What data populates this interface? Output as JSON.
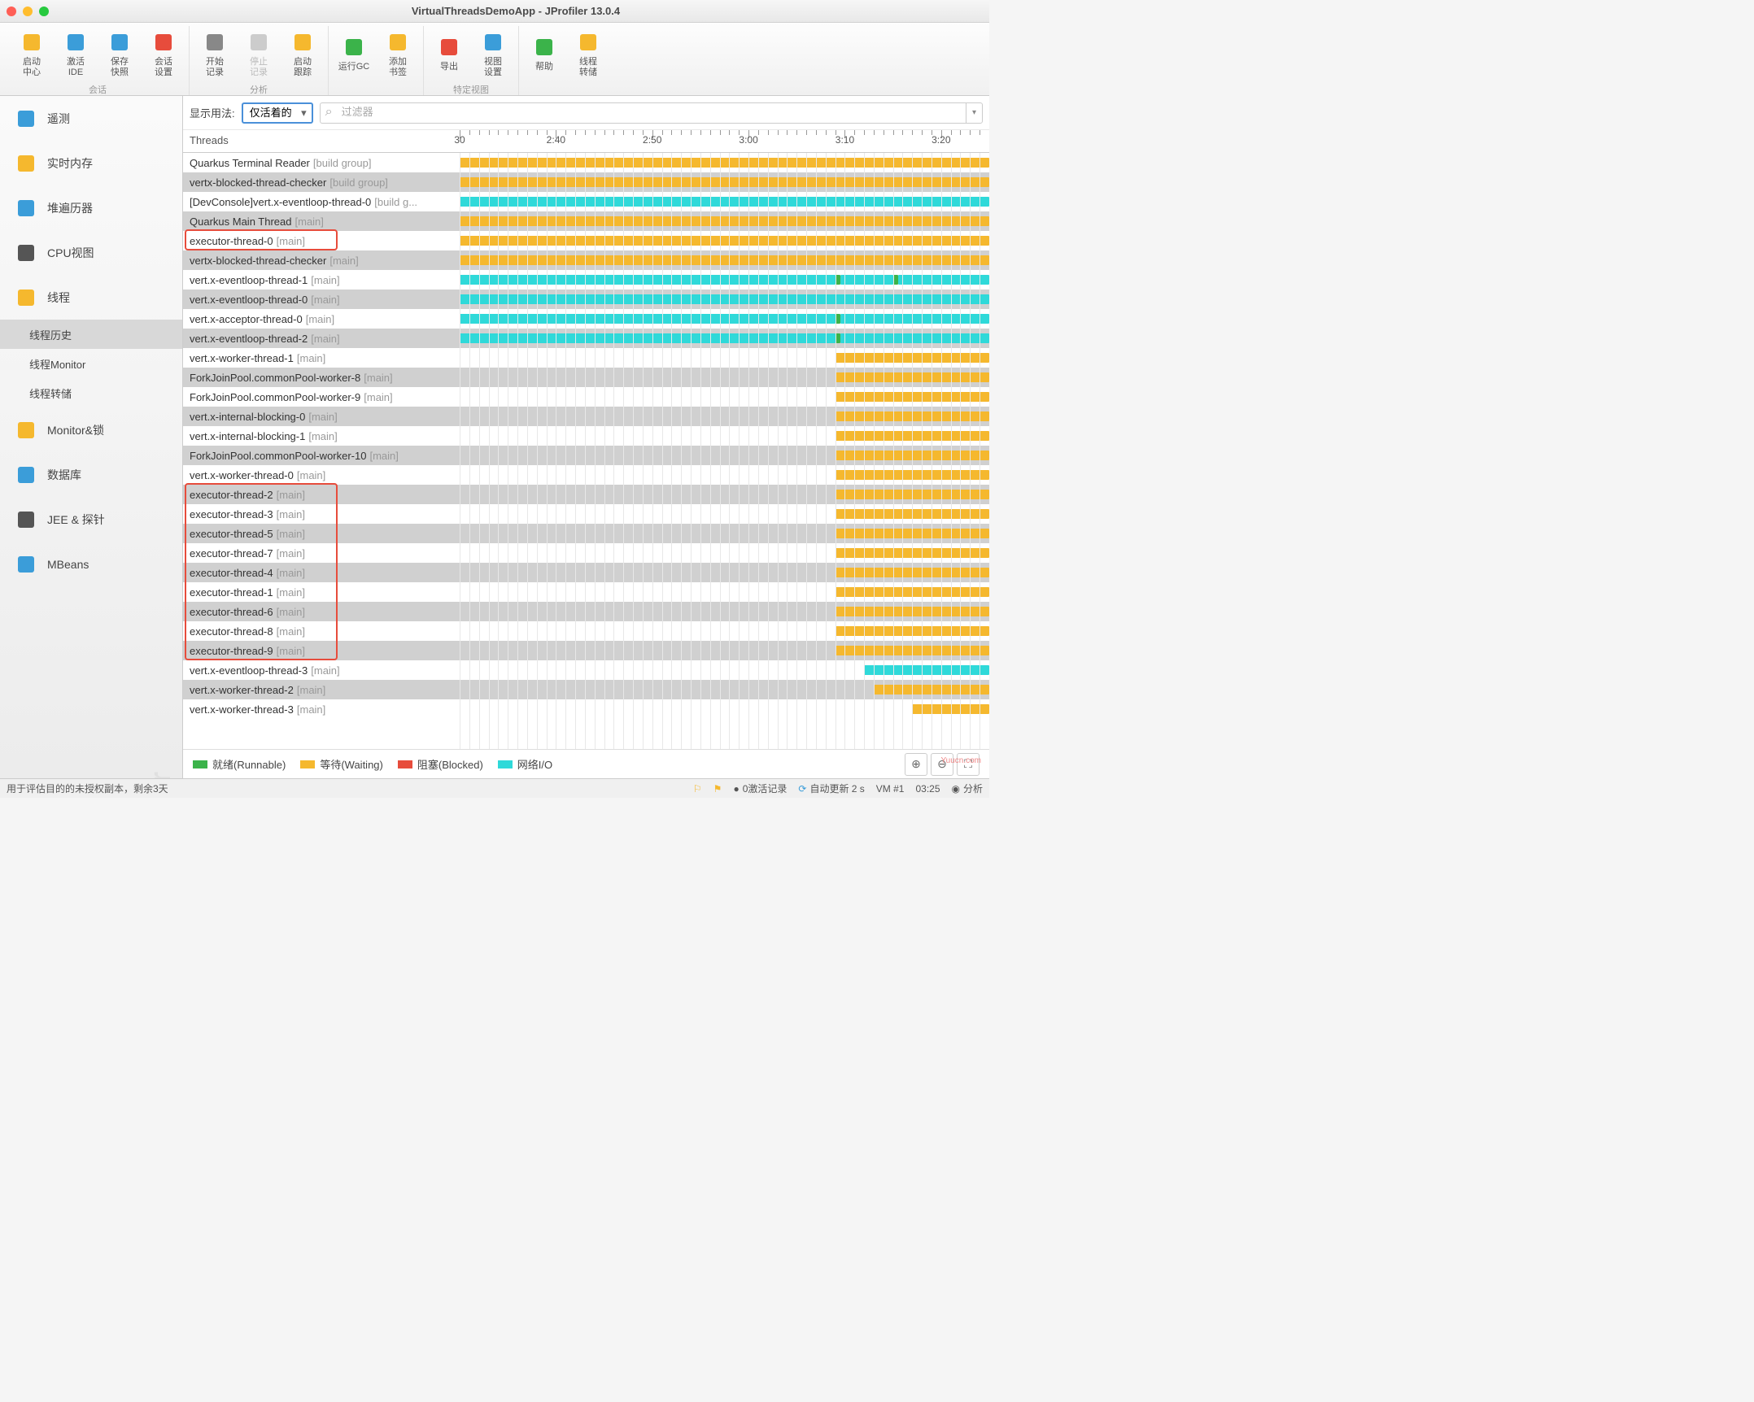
{
  "window_title": "VirtualThreadsDemoApp - JProfiler 13.0.4",
  "toolbar_groups": [
    {
      "label": "会话",
      "buttons": [
        {
          "name": "start-center",
          "label": "启动\n中心",
          "color": "#f5b82e"
        },
        {
          "name": "activate-ide",
          "label": "激活\nIDE",
          "color": "#3b9dd9"
        },
        {
          "name": "save-snapshot",
          "label": "保存\n快照",
          "color": "#3b9dd9"
        },
        {
          "name": "session-settings",
          "label": "会话\n设置",
          "color": "#e74c3c"
        }
      ]
    },
    {
      "label": "分析",
      "buttons": [
        {
          "name": "start-recording",
          "label": "开始\n记录",
          "color": "#888"
        },
        {
          "name": "stop-recording",
          "label": "停止\n记录",
          "color": "#ccc",
          "disabled": true
        },
        {
          "name": "start-tracking",
          "label": "启动\n跟踪",
          "color": "#f5b82e"
        }
      ]
    },
    {
      "label": "",
      "buttons": [
        {
          "name": "run-gc",
          "label": "运行GC",
          "color": "#3bb34a"
        },
        {
          "name": "add-bookmark",
          "label": "添加\n书签",
          "color": "#f5b82e"
        }
      ]
    },
    {
      "label": "特定视图",
      "buttons": [
        {
          "name": "export",
          "label": "导出",
          "color": "#e74c3c"
        },
        {
          "name": "view-settings",
          "label": "视图\n设置",
          "color": "#3b9dd9"
        }
      ]
    },
    {
      "label": "",
      "buttons": [
        {
          "name": "help",
          "label": "帮助",
          "color": "#3bb34a"
        },
        {
          "name": "thread-dump",
          "label": "线程\n转储",
          "color": "#f5b82e"
        }
      ]
    }
  ],
  "sidebar": [
    {
      "name": "telemetry",
      "label": "遥测",
      "icon": "#3b9dd9"
    },
    {
      "name": "live-memory",
      "label": "实时内存",
      "icon": "#f5b82e"
    },
    {
      "name": "heap-walker",
      "label": "堆遍历器",
      "icon": "#3b9dd9"
    },
    {
      "name": "cpu-views",
      "label": "CPU视图",
      "icon": "#555"
    },
    {
      "name": "threads",
      "label": "线程",
      "icon": "#f5b82e",
      "children": [
        {
          "name": "thread-history",
          "label": "线程历史",
          "selected": true
        },
        {
          "name": "thread-monitor",
          "label": "线程Monitor"
        },
        {
          "name": "thread-dumps",
          "label": "线程转储"
        }
      ]
    },
    {
      "name": "monitors-locks",
      "label": "Monitor&锁",
      "icon": "#f5b82e"
    },
    {
      "name": "databases",
      "label": "数据库",
      "icon": "#3b9dd9"
    },
    {
      "name": "jee-probes",
      "label": "JEE & 探针",
      "icon": "#555"
    },
    {
      "name": "mbeans",
      "label": "MBeans",
      "icon": "#3b9dd9"
    }
  ],
  "watermark": "JProfiler",
  "filter": {
    "show_label": "显示用法:",
    "method": "仅活着的",
    "placeholder": "过滤器"
  },
  "threads_header": "Threads",
  "timeline": {
    "start": 150,
    "end": 205,
    "major_ticks": [
      {
        "t": 150,
        "l": "30"
      },
      {
        "t": 160,
        "l": "2:40"
      },
      {
        "t": 170,
        "l": "2:50"
      },
      {
        "t": 180,
        "l": "3:00"
      },
      {
        "t": 190,
        "l": "3:10"
      },
      {
        "t": 200,
        "l": "3:20"
      }
    ]
  },
  "threads": [
    {
      "name": "Quarkus Terminal Reader",
      "grp": "[build group]",
      "segs": [
        {
          "s": 150,
          "e": 205,
          "c": "waiting"
        }
      ]
    },
    {
      "name": "vertx-blocked-thread-checker",
      "grp": "[build group]",
      "segs": [
        {
          "s": 150,
          "e": 205,
          "c": "waiting"
        }
      ]
    },
    {
      "name": "[DevConsole]vert.x-eventloop-thread-0",
      "grp": "[build g...",
      "segs": [
        {
          "s": 150,
          "e": 205,
          "c": "netio"
        }
      ]
    },
    {
      "name": "Quarkus Main Thread",
      "grp": "[main]",
      "segs": [
        {
          "s": 150,
          "e": 205,
          "c": "waiting"
        }
      ]
    },
    {
      "name": "executor-thread-0",
      "grp": "[main]",
      "segs": [
        {
          "s": 150,
          "e": 205,
          "c": "waiting"
        }
      ],
      "hl1": true
    },
    {
      "name": "vertx-blocked-thread-checker",
      "grp": "[main]",
      "segs": [
        {
          "s": 150,
          "e": 205,
          "c": "waiting"
        }
      ]
    },
    {
      "name": "vert.x-eventloop-thread-1",
      "grp": "[main]",
      "segs": [
        {
          "s": 150,
          "e": 189,
          "c": "netio"
        },
        {
          "s": 189,
          "e": 189.5,
          "c": "runnable"
        },
        {
          "s": 189.5,
          "e": 195,
          "c": "netio"
        },
        {
          "s": 195,
          "e": 195.5,
          "c": "runnable"
        },
        {
          "s": 195.5,
          "e": 205,
          "c": "netio"
        }
      ]
    },
    {
      "name": "vert.x-eventloop-thread-0",
      "grp": "[main]",
      "segs": [
        {
          "s": 150,
          "e": 205,
          "c": "netio"
        }
      ]
    },
    {
      "name": "vert.x-acceptor-thread-0",
      "grp": "[main]",
      "segs": [
        {
          "s": 150,
          "e": 189,
          "c": "netio"
        },
        {
          "s": 189,
          "e": 189.5,
          "c": "runnable"
        },
        {
          "s": 189.5,
          "e": 205,
          "c": "netio"
        }
      ]
    },
    {
      "name": "vert.x-eventloop-thread-2",
      "grp": "[main]",
      "segs": [
        {
          "s": 150,
          "e": 189,
          "c": "netio"
        },
        {
          "s": 189,
          "e": 189.5,
          "c": "runnable"
        },
        {
          "s": 189.5,
          "e": 205,
          "c": "netio"
        }
      ]
    },
    {
      "name": "vert.x-worker-thread-1",
      "grp": "[main]",
      "segs": [
        {
          "s": 189,
          "e": 205,
          "c": "waiting"
        }
      ]
    },
    {
      "name": "ForkJoinPool.commonPool-worker-8",
      "grp": "[main]",
      "segs": [
        {
          "s": 189,
          "e": 205,
          "c": "waiting"
        }
      ]
    },
    {
      "name": "ForkJoinPool.commonPool-worker-9",
      "grp": "[main]",
      "segs": [
        {
          "s": 189,
          "e": 205,
          "c": "waiting"
        }
      ]
    },
    {
      "name": "vert.x-internal-blocking-0",
      "grp": "[main]",
      "segs": [
        {
          "s": 189,
          "e": 205,
          "c": "waiting"
        }
      ]
    },
    {
      "name": "vert.x-internal-blocking-1",
      "grp": "[main]",
      "segs": [
        {
          "s": 189,
          "e": 205,
          "c": "waiting"
        }
      ]
    },
    {
      "name": "ForkJoinPool.commonPool-worker-10",
      "grp": "[main]",
      "segs": [
        {
          "s": 189,
          "e": 205,
          "c": "waiting"
        }
      ]
    },
    {
      "name": "vert.x-worker-thread-0",
      "grp": "[main]",
      "segs": [
        {
          "s": 189,
          "e": 205,
          "c": "waiting"
        }
      ]
    },
    {
      "name": "executor-thread-2",
      "grp": "[main]",
      "segs": [
        {
          "s": 189,
          "e": 205,
          "c": "waiting"
        }
      ],
      "hl2": true
    },
    {
      "name": "executor-thread-3",
      "grp": "[main]",
      "segs": [
        {
          "s": 189,
          "e": 205,
          "c": "waiting"
        }
      ],
      "hl2": true
    },
    {
      "name": "executor-thread-5",
      "grp": "[main]",
      "segs": [
        {
          "s": 189,
          "e": 205,
          "c": "waiting"
        }
      ],
      "hl2": true
    },
    {
      "name": "executor-thread-7",
      "grp": "[main]",
      "segs": [
        {
          "s": 189,
          "e": 205,
          "c": "waiting"
        }
      ],
      "hl2": true
    },
    {
      "name": "executor-thread-4",
      "grp": "[main]",
      "segs": [
        {
          "s": 189,
          "e": 205,
          "c": "waiting"
        }
      ],
      "hl2": true
    },
    {
      "name": "executor-thread-1",
      "grp": "[main]",
      "segs": [
        {
          "s": 189,
          "e": 205,
          "c": "waiting"
        }
      ],
      "hl2": true
    },
    {
      "name": "executor-thread-6",
      "grp": "[main]",
      "segs": [
        {
          "s": 189,
          "e": 205,
          "c": "waiting"
        }
      ],
      "hl2": true
    },
    {
      "name": "executor-thread-8",
      "grp": "[main]",
      "segs": [
        {
          "s": 189,
          "e": 205,
          "c": "waiting"
        }
      ],
      "hl2": true
    },
    {
      "name": "executor-thread-9",
      "grp": "[main]",
      "segs": [
        {
          "s": 189,
          "e": 205,
          "c": "waiting"
        }
      ],
      "hl2": true
    },
    {
      "name": "vert.x-eventloop-thread-3",
      "grp": "[main]",
      "segs": [
        {
          "s": 192,
          "e": 205,
          "c": "netio"
        }
      ]
    },
    {
      "name": "vert.x-worker-thread-2",
      "grp": "[main]",
      "segs": [
        {
          "s": 193,
          "e": 205,
          "c": "waiting"
        }
      ]
    },
    {
      "name": "vert.x-worker-thread-3",
      "grp": "[main]",
      "segs": [
        {
          "s": 197,
          "e": 205,
          "c": "waiting"
        }
      ]
    }
  ],
  "legend": [
    {
      "c": "#3bb34a",
      "l": "就绪(Runnable)"
    },
    {
      "c": "#f5b82e",
      "l": "等待(Waiting)"
    },
    {
      "c": "#e74c3c",
      "l": "阻塞(Blocked)"
    },
    {
      "c": "#2fd9d9",
      "l": "网络I/O"
    }
  ],
  "status": {
    "eval": "用于评估目的的未授权副本，剩余3天",
    "active": "0激活记录",
    "auto": "自动更新 2 s",
    "vm": "VM #1",
    "time": "03:25",
    "mode": "分析"
  },
  "watermark_src": "Yuucn.com"
}
